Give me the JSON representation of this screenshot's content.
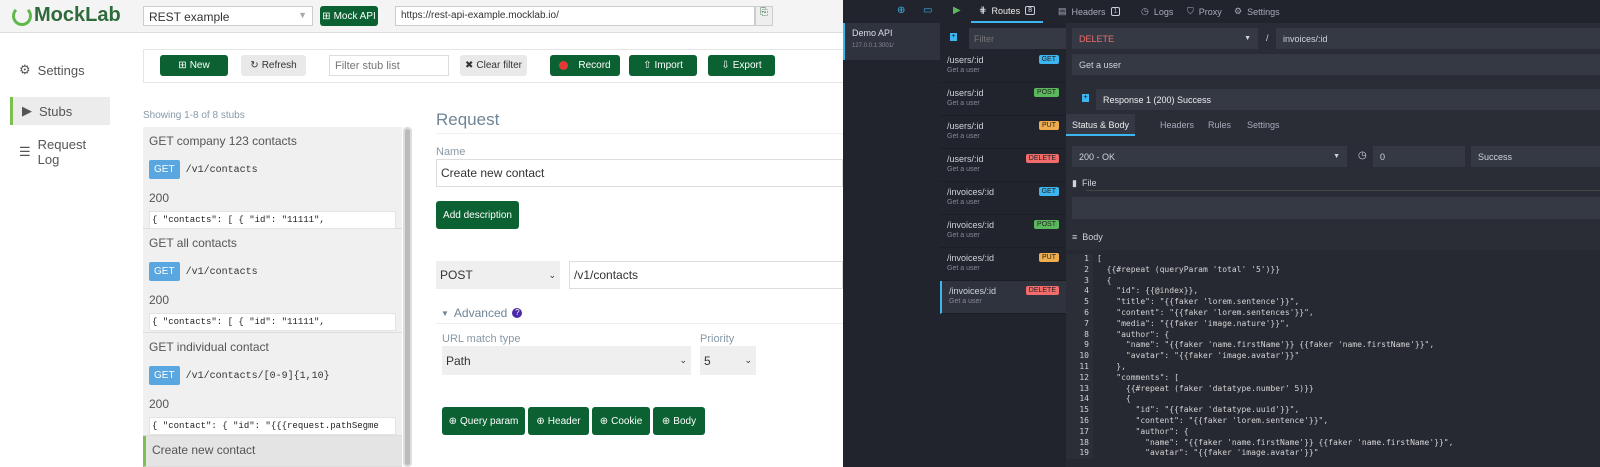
{
  "mocklab": {
    "logo": "MockLab",
    "api_select": "REST example",
    "mock_api_label": "Mock API",
    "base_url": "https://rest-api-example.mocklab.io/",
    "sidebar": [
      {
        "label": "Settings",
        "icon": "gear-icon"
      },
      {
        "label": "Stubs",
        "icon": "play-circle-icon",
        "active": true
      },
      {
        "label": "Request Log",
        "icon": "list-icon"
      }
    ],
    "toolbar": {
      "new": "New",
      "refresh": "Refresh",
      "filter_placeholder": "Filter stub list",
      "clear_filter": "Clear filter",
      "record": "Record",
      "import": "Import",
      "export": "Export"
    },
    "showing": "Showing 1-8 of 8 stubs",
    "stubs": [
      {
        "title": "GET company 123 contacts",
        "method": "GET",
        "path": "/v1/contacts",
        "status": "200",
        "body": "{ \"contacts\": [ { \"id\": \"11111\","
      },
      {
        "title": "GET all contacts",
        "method": "GET",
        "path": "/v1/contacts",
        "status": "200",
        "body": "{ \"contacts\": [ { \"id\": \"11111\","
      },
      {
        "title": "GET individual contact",
        "method": "GET",
        "path": "/v1/contacts/[0-9]{1,10}",
        "status": "200",
        "body": "{ \"contact\": { \"id\": \"{{{request.pathSegme"
      },
      {
        "title": "Create new contact"
      }
    ],
    "request": {
      "heading": "Request",
      "name_label": "Name",
      "name_value": "Create new contact",
      "add_description": "Add description",
      "method": "POST",
      "url": "/v1/contacts",
      "advanced": "Advanced",
      "url_match_label": "URL match type",
      "url_match_value": "Path",
      "priority_label": "Priority",
      "priority_value": "5",
      "buttons": [
        "Query param",
        "Header",
        "Cookie",
        "Body"
      ]
    }
  },
  "mockoon": {
    "environment": {
      "name": "Demo API",
      "address": "127.0.0.1:3001/"
    },
    "tabs": [
      {
        "label": "Routes",
        "count": "8",
        "active": true
      },
      {
        "label": "Headers",
        "count": "1"
      },
      {
        "label": "Logs"
      },
      {
        "label": "Proxy"
      },
      {
        "label": "Settings"
      }
    ],
    "filter_placeholder": "Filter",
    "routes": [
      {
        "path": "/users/:id",
        "desc": "Get a user",
        "method": "GET"
      },
      {
        "path": "/users/:id",
        "desc": "Get a user",
        "method": "POST"
      },
      {
        "path": "/users/:id",
        "desc": "Get a user",
        "method": "PUT"
      },
      {
        "path": "/users/:id",
        "desc": "Get a user",
        "method": "DELETE"
      },
      {
        "path": "/invoices/:id",
        "desc": "Get a user",
        "method": "GET"
      },
      {
        "path": "/invoices/:id",
        "desc": "Get a user",
        "method": "POST"
      },
      {
        "path": "/invoices/:id",
        "desc": "Get a user",
        "method": "PUT"
      },
      {
        "path": "/invoices/:id",
        "desc": "Get a user",
        "method": "DELETE",
        "active": true
      }
    ],
    "method_colors": {
      "GET": "#3db5ef",
      "POST": "#5cb85c",
      "PUT": "#f0ad4e",
      "DELETE": "#f26c6c"
    },
    "route_method": "DELETE",
    "route_path": "invoices/:id",
    "route_desc": "Get a user",
    "response_label": "Response 1 (200)  Success",
    "response_tabs": [
      "Status & Body",
      "Headers",
      "Rules",
      "Settings"
    ],
    "status": "200 - OK",
    "latency": "0",
    "response_name": "Success",
    "file_label": "File",
    "body_label": "Body",
    "code": [
      "[",
      "  {{#repeat (queryParam 'total' '5')}}",
      "  {",
      "    \"id\": {{@index}},",
      "    \"title\": \"{{faker 'lorem.sentence'}}\",",
      "    \"content\": \"{{faker 'lorem.sentences'}}\",",
      "    \"media\": \"{{faker 'image.nature'}}\",",
      "    \"author\": {",
      "      \"name\": \"{{faker 'name.firstName'}} {{faker 'name.firstName'}}\",",
      "      \"avatar\": \"{{faker 'image.avatar'}}\"",
      "    },",
      "    \"comments\": [",
      "      {{#repeat (faker 'datatype.number' 5)}}",
      "      {",
      "        \"id\": \"{{faker 'datatype.uuid'}}\",",
      "        \"content\": \"{{faker 'lorem.sentence'}}\",",
      "        \"author\": {",
      "          \"name\": \"{{faker 'name.firstName'}} {{faker 'name.firstName'}}\",",
      "          \"avatar\": \"{{faker 'image.avatar'}}\""
    ]
  }
}
